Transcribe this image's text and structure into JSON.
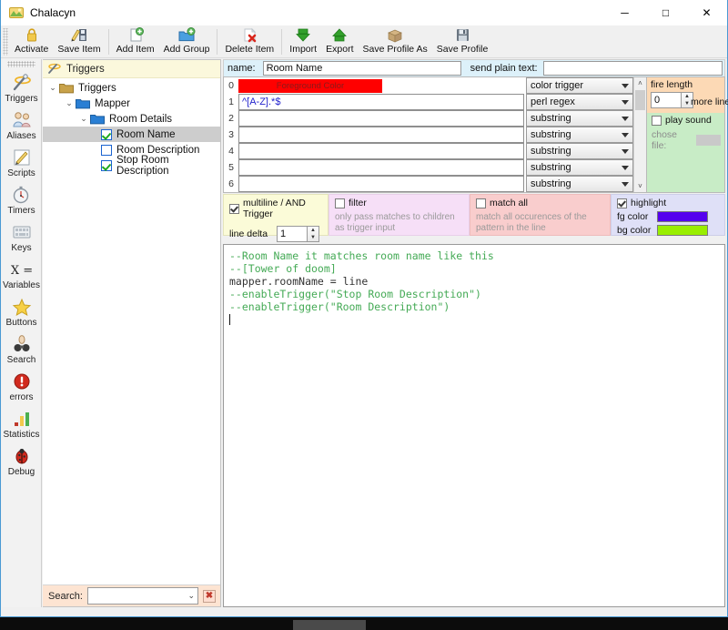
{
  "window": {
    "title": "Chalacyn",
    "icon": "app-icon",
    "minimize": "─",
    "maximize": "□",
    "close": "✕"
  },
  "toolbar": {
    "items": [
      {
        "label": "Activate",
        "icon": "lock-icon"
      },
      {
        "label": "Save Item",
        "icon": "save-item-icon"
      },
      {
        "label": "Add Item",
        "icon": "add-item-icon"
      },
      {
        "label": "Add Group",
        "icon": "add-group-icon"
      },
      {
        "label": "Delete Item",
        "icon": "delete-item-icon"
      },
      {
        "label": "Import",
        "icon": "import-arrow-down-icon"
      },
      {
        "label": "Export",
        "icon": "export-arrow-up-icon"
      },
      {
        "label": "Save Profile As",
        "icon": "box-icon"
      },
      {
        "label": "Save Profile",
        "icon": "floppy-disk-icon"
      }
    ]
  },
  "rail": {
    "items": [
      {
        "label": "Triggers",
        "icon": "magic-wand-icon"
      },
      {
        "label": "Aliases",
        "icon": "people-icon"
      },
      {
        "label": "Scripts",
        "icon": "pencil-note-icon"
      },
      {
        "label": "Timers",
        "icon": "stopwatch-icon"
      },
      {
        "label": "Keys",
        "icon": "keyboard-icon"
      },
      {
        "label": "Variables",
        "icon": "x-equals-icon"
      },
      {
        "label": "Buttons",
        "icon": "star-icon"
      },
      {
        "label": "Search",
        "icon": "binoculars-icon"
      },
      {
        "label": "errors",
        "icon": "error-circle-icon"
      },
      {
        "label": "Statistics",
        "icon": "bar-chart-icon"
      },
      {
        "label": "Debug",
        "icon": "ladybug-icon"
      }
    ]
  },
  "tree": {
    "header": {
      "label": "Triggers",
      "icon": "magic-wand-icon"
    },
    "nodes": [
      {
        "label": "Triggers",
        "type": "folder",
        "folder_color": "#c8a24a",
        "indent": 0,
        "expanded": true,
        "arrow": "⌄"
      },
      {
        "label": "Mapper",
        "type": "folder",
        "folder_color": "#2a7fd4",
        "indent": 1,
        "expanded": true,
        "arrow": "⌄"
      },
      {
        "label": "Room Details",
        "type": "folder",
        "folder_color": "#2a7fd4",
        "indent": 2,
        "expanded": true,
        "arrow": "⌄"
      },
      {
        "label": "Room Name",
        "type": "item",
        "checked": true,
        "indent": 3,
        "selected": true
      },
      {
        "label": "Room Description",
        "type": "item",
        "checked": false,
        "indent": 3,
        "selected": false
      },
      {
        "label": "Stop Room Description",
        "type": "item",
        "checked": true,
        "indent": 3,
        "selected": false
      }
    ]
  },
  "search": {
    "label": "Search:",
    "value": "",
    "chevron": "⌄",
    "close_icon": "✖"
  },
  "editor_form": {
    "name_label": "name:",
    "name_value": "Room Name",
    "plain_text_label": "send plain text:",
    "plain_text_value": "",
    "patterns": [
      {
        "index": "0",
        "text": "",
        "type": "color trigger",
        "is_color": true,
        "fg_label": "Foreground Color",
        "fg_color": "#ff0000",
        "bg_color": "#000000"
      },
      {
        "index": "1",
        "text": "^[A-Z].*$",
        "type": "perl regex",
        "is_color": false
      },
      {
        "index": "2",
        "text": "",
        "type": "substring",
        "is_color": false
      },
      {
        "index": "3",
        "text": "",
        "type": "substring",
        "is_color": false
      },
      {
        "index": "4",
        "text": "",
        "type": "substring",
        "is_color": false
      },
      {
        "index": "5",
        "text": "",
        "type": "substring",
        "is_color": false
      },
      {
        "index": "6",
        "text": "",
        "type": "substring",
        "is_color": false
      }
    ],
    "scroll_up": "˄",
    "scroll_down": "˅"
  },
  "fire_length": {
    "title": "fire length",
    "value": "0",
    "suffix": "more lines",
    "play_sound_label": "play sound",
    "play_sound_checked": false,
    "chose_file_label": "chose file:"
  },
  "options": {
    "multiline": {
      "label": "multiline / AND Trigger",
      "checked": true,
      "line_delta_label": "line delta",
      "line_delta_value": "1"
    },
    "filter": {
      "label": "filter",
      "checked": false,
      "description": "only pass matches to children as trigger input"
    },
    "match_all": {
      "label": "match all",
      "checked": false,
      "description": "match all occurences of the pattern in the line"
    },
    "highlight": {
      "label": "highlight",
      "checked": true,
      "fg_label": "fg color",
      "bg_label": "bg color",
      "fg_color": "#5500ee",
      "bg_color": "#99ee00"
    }
  },
  "script": {
    "lines": [
      {
        "text": "--Room Name it matches room name like this",
        "style": "comment"
      },
      {
        "text": "--[Tower of doom]",
        "style": "comment"
      },
      {
        "text": "mapper.roomName = line",
        "style": "plain"
      },
      {
        "text": "--enableTrigger(\"Stop Room Description\")",
        "style": "comment"
      },
      {
        "text": "--enableTrigger(\"Room Description\")",
        "style": "comment"
      }
    ]
  }
}
